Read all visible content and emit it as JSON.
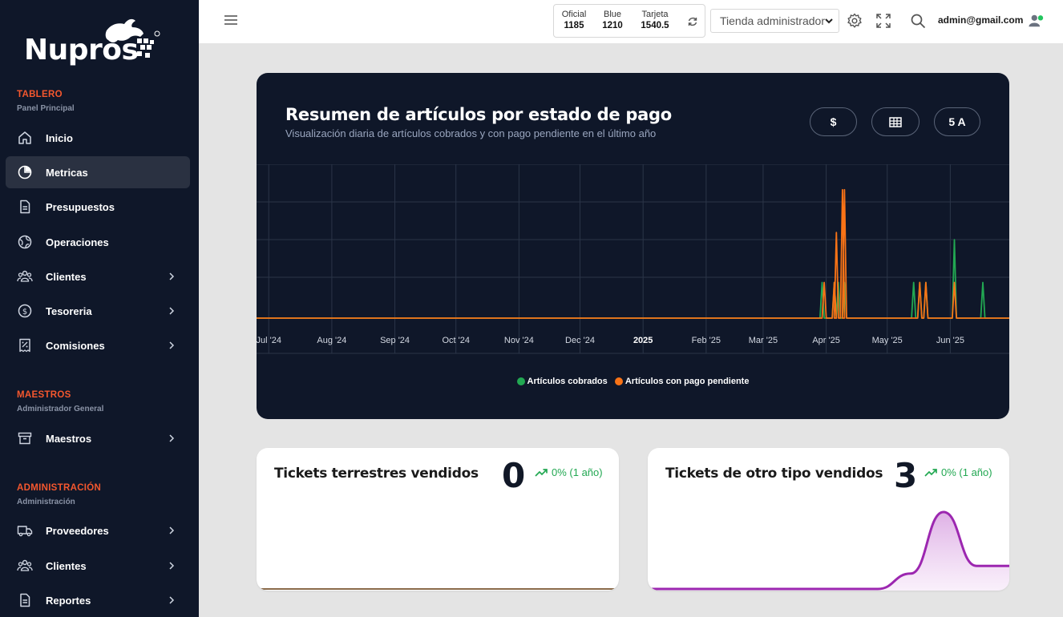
{
  "app": {
    "brand": "Nupros"
  },
  "sidebar": {
    "sections": [
      {
        "title": "TABLERO",
        "subtitle": "Panel Principal"
      },
      {
        "title": "MAESTROS",
        "subtitle": "Administrador General"
      },
      {
        "title": "ADMINISTRACIÓN",
        "subtitle": "Administración"
      }
    ],
    "items": [
      {
        "label": "Inicio",
        "icon": "home-icon"
      },
      {
        "label": "Metricas",
        "icon": "pie-chart-icon",
        "active": true
      },
      {
        "label": "Presupuestos",
        "icon": "document-icon"
      },
      {
        "label": "Operaciones",
        "icon": "globe-icon"
      },
      {
        "label": "Clientes",
        "icon": "users-icon"
      },
      {
        "label": "Tesoreria",
        "icon": "dollar-circle-icon"
      },
      {
        "label": "Comisiones",
        "icon": "receipt-percent-icon"
      },
      {
        "label": "Maestros",
        "icon": "archive-icon"
      },
      {
        "label": "Proveedores",
        "icon": "truck-icon"
      },
      {
        "label": "Clientes",
        "icon": "users-icon"
      },
      {
        "label": "Reportes",
        "icon": "document-icon"
      }
    ]
  },
  "topbar": {
    "rates": [
      {
        "name": "Oficial",
        "value": "1185"
      },
      {
        "name": "Blue",
        "value": "1210"
      },
      {
        "name": "Tarjeta",
        "value": "1540.5"
      }
    ],
    "store_select": "Tienda administrador",
    "user_email": "admin@gmail.com"
  },
  "chart_card": {
    "title": "Resumen de artículos por estado de pago",
    "subtitle": "Visualización diaria de artículos cobrados y con pago pendiente en el último año",
    "buttons": [
      "$",
      "grid-icon",
      "5 A"
    ]
  },
  "chart_data": {
    "type": "line",
    "title": "Resumen de artículos por estado de pago",
    "x_ticks": [
      "Jul '24",
      "Aug '24",
      "Sep '24",
      "Oct '24",
      "Nov '24",
      "Dec '24",
      "2025",
      "Feb '25",
      "Mar '25",
      "Apr '25",
      "May '25",
      "Jun '25"
    ],
    "x_range": [
      "2024-06-25",
      "2025-06-30"
    ],
    "y_range": [
      0,
      4
    ],
    "grid": true,
    "legend_position": "bottom",
    "series": [
      {
        "name": "Artículos cobrados",
        "color": "#22a852",
        "points": [
          [
            "2025-03-30",
            1
          ],
          [
            "2025-04-05",
            1
          ],
          [
            "2025-04-07",
            1
          ],
          [
            "2025-04-10",
            1
          ],
          [
            "2025-05-14",
            1
          ],
          [
            "2025-05-17",
            1
          ],
          [
            "2025-05-20",
            1
          ],
          [
            "2025-06-03",
            2.2
          ],
          [
            "2025-06-17",
            1
          ]
        ]
      },
      {
        "name": "Artículos con pago pendiente",
        "color": "#f97316",
        "points": [
          [
            "2025-03-31",
            1
          ],
          [
            "2025-04-05",
            1
          ],
          [
            "2025-04-06",
            2.4
          ],
          [
            "2025-04-09",
            3.6
          ],
          [
            "2025-04-10",
            3.6
          ],
          [
            "2025-05-17",
            1
          ],
          [
            "2025-05-20",
            1
          ],
          [
            "2025-06-03",
            1
          ]
        ]
      }
    ]
  },
  "kpis": [
    {
      "title": "Tickets terrestres vendidos",
      "value": "0",
      "trend": "0% (1 año)",
      "sparkline": [
        0,
        0,
        0,
        0,
        0,
        0,
        0,
        0,
        0,
        0,
        0,
        0
      ]
    },
    {
      "title": "Tickets de otro tipo vendidos",
      "value": "3",
      "trend": "0% (1 año)",
      "sparkline": [
        0,
        0,
        0,
        0,
        0,
        0,
        0,
        0,
        0.2,
        1,
        0.3,
        0.3
      ]
    }
  ],
  "colors": {
    "accent": "#f4572e",
    "sidebar_bg": "#0f1729",
    "positive": "#22a852",
    "sparkline": "#9c27b0"
  }
}
